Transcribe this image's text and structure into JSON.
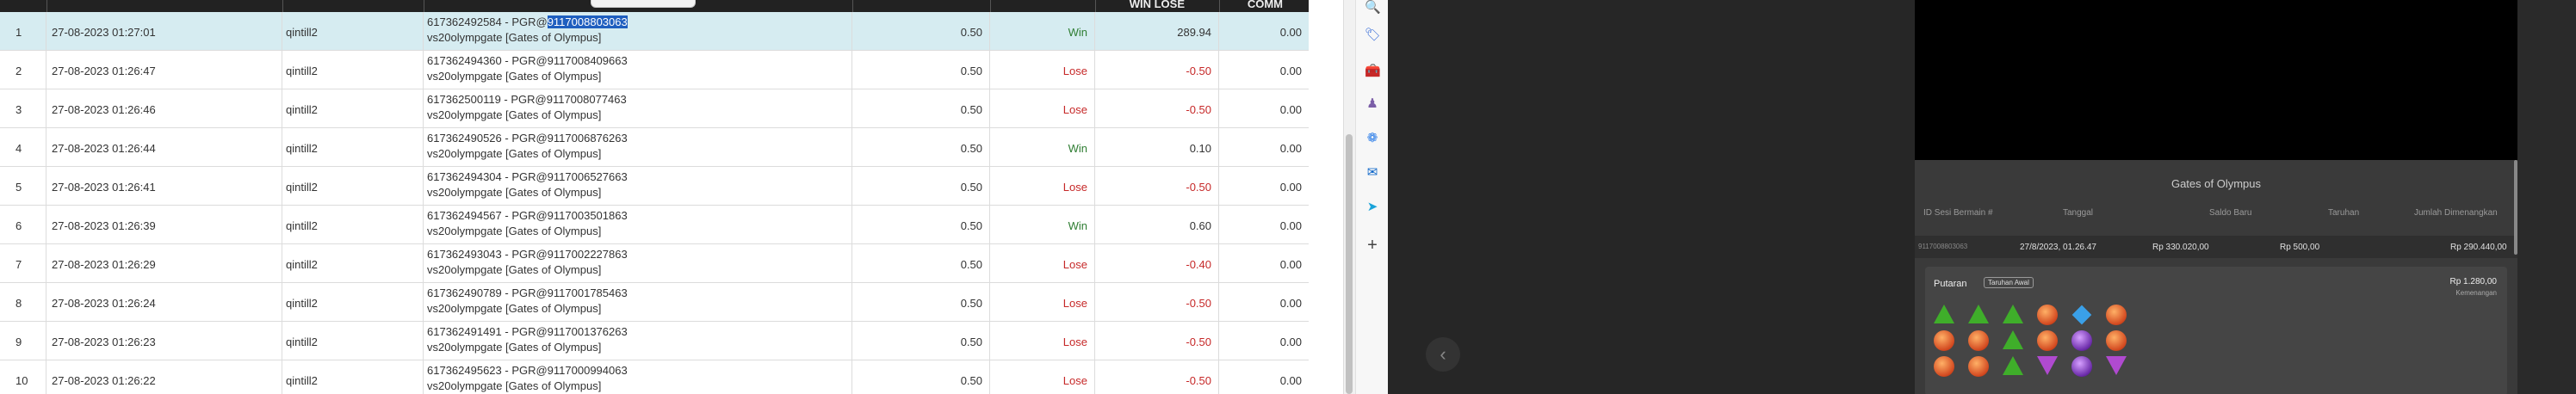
{
  "table": {
    "headers": {
      "win_lose": "WIN LOSE",
      "comm": "COMM"
    },
    "rows": [
      {
        "no": "1",
        "date": "27-08-2023 01:27:01",
        "user": "qintill2",
        "desc_prefix": "617362492584 - PGR@",
        "desc_hl": "9117008803063",
        "desc_line2": "vs20olympgate [Gates of Olympus]",
        "bet": "0.50",
        "status": "Win",
        "win_lose": "289.94",
        "comm": "0.00"
      },
      {
        "no": "2",
        "date": "27-08-2023 01:26:47",
        "user": "qintill2",
        "desc_prefix": "617362494360 - PGR@9117008409663",
        "desc_hl": "",
        "desc_line2": "vs20olympgate [Gates of Olympus]",
        "bet": "0.50",
        "status": "Lose",
        "win_lose": "-0.50",
        "comm": "0.00"
      },
      {
        "no": "3",
        "date": "27-08-2023 01:26:46",
        "user": "qintill2",
        "desc_prefix": "617362500119 - PGR@9117008077463",
        "desc_hl": "",
        "desc_line2": "vs20olympgate [Gates of Olympus]",
        "bet": "0.50",
        "status": "Lose",
        "win_lose": "-0.50",
        "comm": "0.00"
      },
      {
        "no": "4",
        "date": "27-08-2023 01:26:44",
        "user": "qintill2",
        "desc_prefix": "617362490526 - PGR@9117006876263",
        "desc_hl": "",
        "desc_line2": "vs20olympgate [Gates of Olympus]",
        "bet": "0.50",
        "status": "Win",
        "win_lose": "0.10",
        "comm": "0.00"
      },
      {
        "no": "5",
        "date": "27-08-2023 01:26:41",
        "user": "qintill2",
        "desc_prefix": "617362494304 - PGR@9117006527663",
        "desc_hl": "",
        "desc_line2": "vs20olympgate [Gates of Olympus]",
        "bet": "0.50",
        "status": "Lose",
        "win_lose": "-0.50",
        "comm": "0.00"
      },
      {
        "no": "6",
        "date": "27-08-2023 01:26:39",
        "user": "qintill2",
        "desc_prefix": "617362494567 - PGR@9117003501863",
        "desc_hl": "",
        "desc_line2": "vs20olympgate [Gates of Olympus]",
        "bet": "0.50",
        "status": "Win",
        "win_lose": "0.60",
        "comm": "0.00"
      },
      {
        "no": "7",
        "date": "27-08-2023 01:26:29",
        "user": "qintill2",
        "desc_prefix": "617362493043 - PGR@9117002227863",
        "desc_hl": "",
        "desc_line2": "vs20olympgate [Gates of Olympus]",
        "bet": "0.50",
        "status": "Lose",
        "win_lose": "-0.40",
        "comm": "0.00"
      },
      {
        "no": "8",
        "date": "27-08-2023 01:26:24",
        "user": "qintill2",
        "desc_prefix": "617362490789 - PGR@9117001785463",
        "desc_hl": "",
        "desc_line2": "vs20olympgate [Gates of Olympus]",
        "bet": "0.50",
        "status": "Lose",
        "win_lose": "-0.50",
        "comm": "0.00"
      },
      {
        "no": "9",
        "date": "27-08-2023 01:26:23",
        "user": "qintill2",
        "desc_prefix": "617362491491 - PGR@9117001376263",
        "desc_hl": "",
        "desc_line2": "vs20olympgate [Gates of Olympus]",
        "bet": "0.50",
        "status": "Lose",
        "win_lose": "-0.50",
        "comm": "0.00"
      },
      {
        "no": "10",
        "date": "27-08-2023 01:26:22",
        "user": "qintill2",
        "desc_prefix": "617362495623 - PGR@9117000994063",
        "desc_hl": "",
        "desc_line2": "vs20olympgate [Gates of Olympus]",
        "bet": "0.50",
        "status": "Lose",
        "win_lose": "-0.50",
        "comm": "0.00"
      }
    ]
  },
  "sidebar": {
    "icons": [
      "search-icon",
      "tag-icon",
      "toolbox-icon",
      "person-icon",
      "copilot-icon",
      "outlook-icon",
      "send-icon",
      "add-icon"
    ]
  },
  "game": {
    "title": "Gates of Olympus",
    "columns": [
      "ID Sesi Bermain #",
      "Tanggal",
      "Saldo Baru",
      "Taruhan",
      "Jumlah Dimenangkan"
    ],
    "history": {
      "id": "9117008803063",
      "date": "27/8/2023, 01.26.47",
      "saldo": "Rp 330.020,00",
      "taruhan": "Rp 500,00",
      "menang": "Rp 290.440,00"
    },
    "spin": {
      "label": "Putaran",
      "tag": "Taruhan Awal",
      "amount": "Rp 1.280,00",
      "sub": "Kemenangan"
    },
    "grid": [
      [
        "green",
        "green",
        "green",
        "orange",
        "blue",
        "orange"
      ],
      [
        "orange",
        "orange",
        "green",
        "orange",
        "violet",
        "orange"
      ],
      [
        "orange",
        "orange",
        "green",
        "purple",
        "violet",
        "purple"
      ]
    ]
  },
  "colors": {
    "win": "#2e7d32",
    "lose": "#c62828",
    "selected_row": "#d6ecf1",
    "highlight": "#1f5fbf"
  }
}
